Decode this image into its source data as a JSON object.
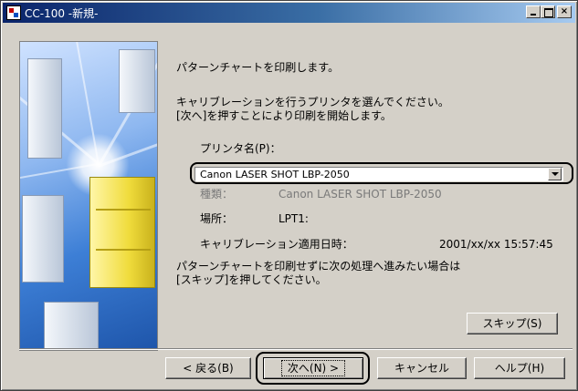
{
  "window": {
    "title": "CC-100 -新規-",
    "minimize_label": "",
    "maximize_label": "",
    "close_label": "×"
  },
  "intro": "パターンチャートを印刷します。",
  "instruction_line1": "キャリブレーションを行うプリンタを選んでください。",
  "instruction_line2": "[次へ]を押すことにより印刷を開始します。",
  "printer_name_label": "プリンタ名(P)：",
  "printer_select": {
    "value": "Canon LASER SHOT LBP-2050"
  },
  "details": {
    "type_label": "種類：",
    "type_value": "Canon LASER SHOT LBP-2050",
    "location_label": "場所：",
    "location_value": "LPT1:",
    "calibration_date_label": "キャリブレーション適用日時：",
    "calibration_date_value": "2001/xx/xx 15:57:45"
  },
  "skip_note_line1": "パターンチャートを印刷せずに次の処理へ進みたい場合は",
  "skip_note_line2": "[スキップ]を押してください。",
  "buttons": {
    "skip": "スキップ(S)",
    "back": "< 戻る(B)",
    "next": "次へ(N) >",
    "cancel": "キャンセル",
    "help": "ヘルプ(H)"
  }
}
